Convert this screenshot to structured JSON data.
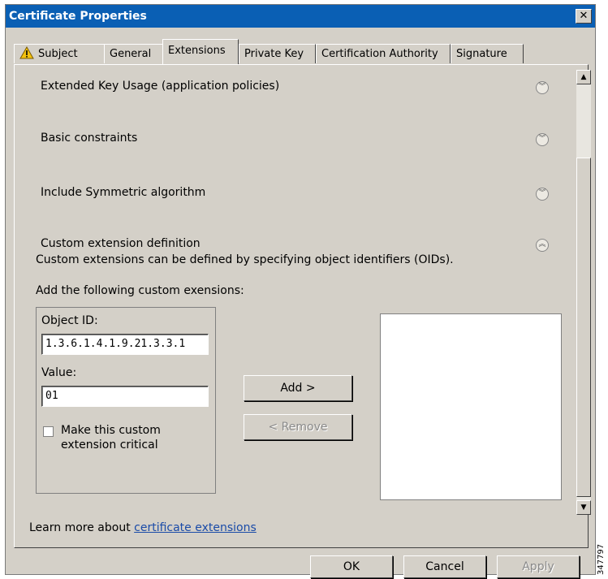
{
  "window": {
    "title": "Certificate Properties",
    "close_label": "✕"
  },
  "tabs": [
    {
      "label": "Subject"
    },
    {
      "label": "General"
    },
    {
      "label": "Extensions"
    },
    {
      "label": "Private Key"
    },
    {
      "label": "Certification Authority"
    },
    {
      "label": "Signature"
    }
  ],
  "sections": [
    {
      "label": "Extended Key Usage (application policies)",
      "state": "collapsed"
    },
    {
      "label": "Basic constraints",
      "state": "collapsed"
    },
    {
      "label": "Include Symmetric algorithm",
      "state": "collapsed"
    },
    {
      "label": "Custom extension definition",
      "state": "expanded"
    }
  ],
  "custom": {
    "description": "Custom extensions can be defined by specifying object identifiers (OIDs).",
    "add_heading": "Add the following custom exensions:",
    "object_id_label": "Object ID:",
    "object_id_value": "1.3.6.1.4.1.9.21.3.3.1",
    "value_label": "Value:",
    "value_value": "01",
    "critical_label_line1": "Make this custom",
    "critical_label_line2": "extension critical",
    "critical_checked": false,
    "add_button": "Add >",
    "remove_button": "< Remove"
  },
  "learn_more": {
    "prefix": "Learn more about ",
    "link": "certificate extensions"
  },
  "footer": {
    "ok": "OK",
    "cancel": "Cancel",
    "apply": "Apply"
  },
  "figure_id": "347797",
  "colors": {
    "title_bar": "#0a5fb4",
    "dialog_bg": "#d4d0c8",
    "link": "#1a4ba8"
  }
}
